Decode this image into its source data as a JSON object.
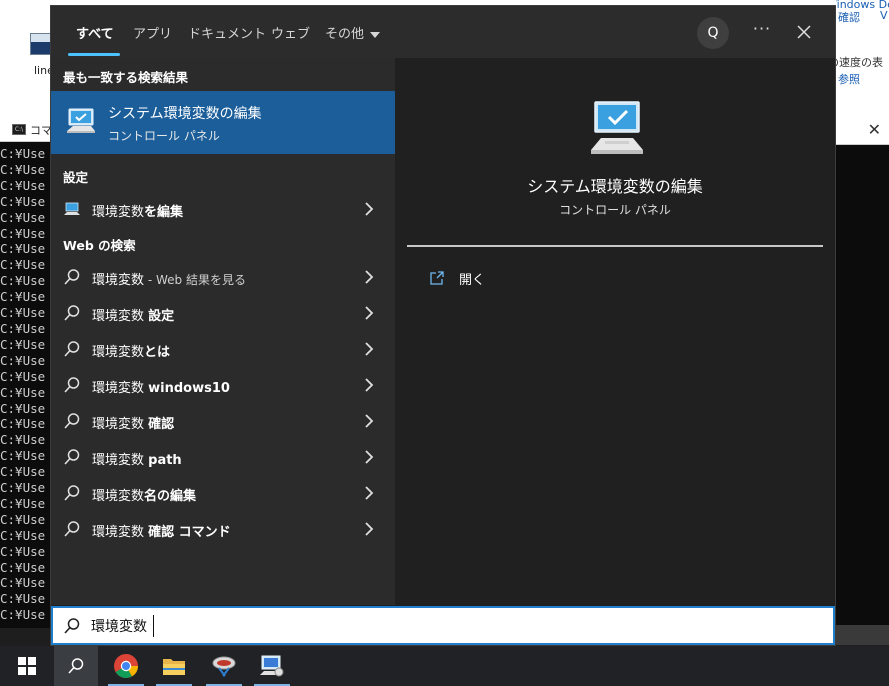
{
  "background": {
    "desktop_icon_label": "line",
    "top_right_texts": [
      "Windows Defender ファ",
      "確認",
      "V",
      "の速度の表",
      "参照"
    ],
    "cmd_title": "コマ",
    "cmd_prompt": "C:¥Use"
  },
  "tabs": [
    {
      "label": "すべて",
      "active": true
    },
    {
      "label": "アプリ"
    },
    {
      "label": "ドキュメント"
    },
    {
      "label": "ウェブ"
    },
    {
      "label": "その他"
    }
  ],
  "header_buttons": {
    "avatar": "Q",
    "more": "···"
  },
  "best_match": {
    "header": "最も一致する検索結果",
    "title": "システム環境変数の編集",
    "subtitle": "コントロール パネル"
  },
  "settings": {
    "header": "設定",
    "item": {
      "pre": "環境変数",
      "bold": "を編集"
    }
  },
  "web": {
    "header": "Web の検索",
    "items": [
      {
        "pre": "環境変数",
        "bold": "",
        "muted": " - Web 結果を見る"
      },
      {
        "pre": "環境変数 ",
        "bold": "設定",
        "muted": ""
      },
      {
        "pre": "環境変数",
        "bold": "とは",
        "muted": ""
      },
      {
        "pre": "環境変数 ",
        "bold": "windows10",
        "muted": ""
      },
      {
        "pre": "環境変数 ",
        "bold": "確認",
        "muted": ""
      },
      {
        "pre": "環境変数 ",
        "bold": "path",
        "muted": ""
      },
      {
        "pre": "環境変数",
        "bold": "名の編集",
        "muted": ""
      },
      {
        "pre": "環境変数 ",
        "bold": "確認 コマンド",
        "muted": ""
      }
    ]
  },
  "preview": {
    "title": "システム環境変数の編集",
    "subtitle": "コントロール パネル",
    "open_label": "開く"
  },
  "search": {
    "value": "環境変数"
  },
  "colors": {
    "accent": "#4cc2ff",
    "selected": "#1b5e9a",
    "search_border": "#1f7fcc"
  }
}
